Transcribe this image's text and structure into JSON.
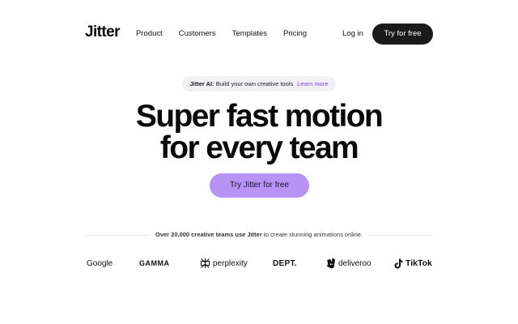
{
  "nav": {
    "logo": "Jitter",
    "items": [
      "Product",
      "Customers",
      "Templates",
      "Pricing"
    ],
    "login": "Log in",
    "cta": "Try for free"
  },
  "announcement": {
    "bold": "Jitter AI:",
    "text": "Build your own creative tools",
    "link": "Learn more"
  },
  "hero": {
    "line1": "Super fast motion",
    "line2": "for every team",
    "cta": "Try Jitter for free"
  },
  "trust": {
    "bold": "Over 20,000 creative teams use Jitter",
    "text": "to create stunning animations online."
  },
  "logos": [
    {
      "name": "Google",
      "icon": "none"
    },
    {
      "name": "GAMMA",
      "icon": "none"
    },
    {
      "name": "perplexity",
      "icon": "perplexity-icon"
    },
    {
      "name": "DEPT.",
      "icon": "none"
    },
    {
      "name": "deliveroo",
      "icon": "deliveroo-icon"
    },
    {
      "name": "TikTok",
      "icon": "tiktok-icon"
    }
  ],
  "colors": {
    "nav_cta_bg": "#1a1a1a",
    "hero_cta_bg": "#b893f6",
    "link": "#7a43e6",
    "announce_bg": "#f1f1f3"
  }
}
